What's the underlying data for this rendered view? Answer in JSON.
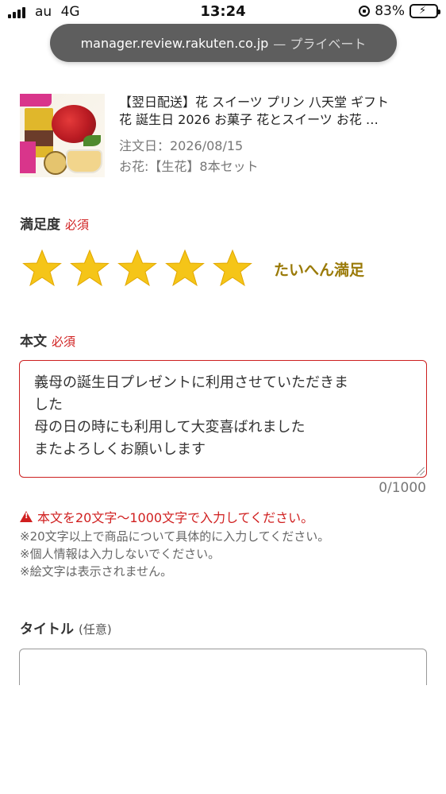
{
  "status_bar": {
    "carrier": "au",
    "network": "4G",
    "time": "13:24",
    "battery_percent": "83%",
    "battery_level": 0.83,
    "battery_color": "#4cd964"
  },
  "url_bar": {
    "host": "manager.review.rakuten.co.jp",
    "private_label": "— プライベート"
  },
  "product": {
    "title_line1": "【翌日配送】花 スイーツ プリン 八天堂 ギフト",
    "title_line2": "花  誕生日  2026 お菓子 花とスイーツ お花 …",
    "order_date": "注文日：2026/08/15",
    "option": "お花:【生花】8本セット",
    "thumb_icon": "flower-and-pudding-gift-image"
  },
  "satisfaction": {
    "label": "満足度",
    "required": "必須",
    "stars": 5,
    "star_max": 5,
    "star_color": "#f5c518",
    "rating_text": "たいへん満足"
  },
  "body": {
    "label": "本文",
    "required": "必須",
    "lines": [
      "義母の誕生日プレゼントに利用させていただきま",
      "した",
      "母の日の時にも利用して大変喜ばれました",
      "またよろしくお願いします"
    ],
    "counter": "0/1000",
    "error": "本文を20文字～1000文字で入力してください。",
    "notes": [
      "※20文字以上で商品について具体的に入力してください。",
      "※個人情報は入力しないでください。",
      "※絵文字は表示されません。"
    ],
    "error_color": "#d01f1f"
  },
  "title_field": {
    "label": "タイトル",
    "optional": "(任意)"
  }
}
